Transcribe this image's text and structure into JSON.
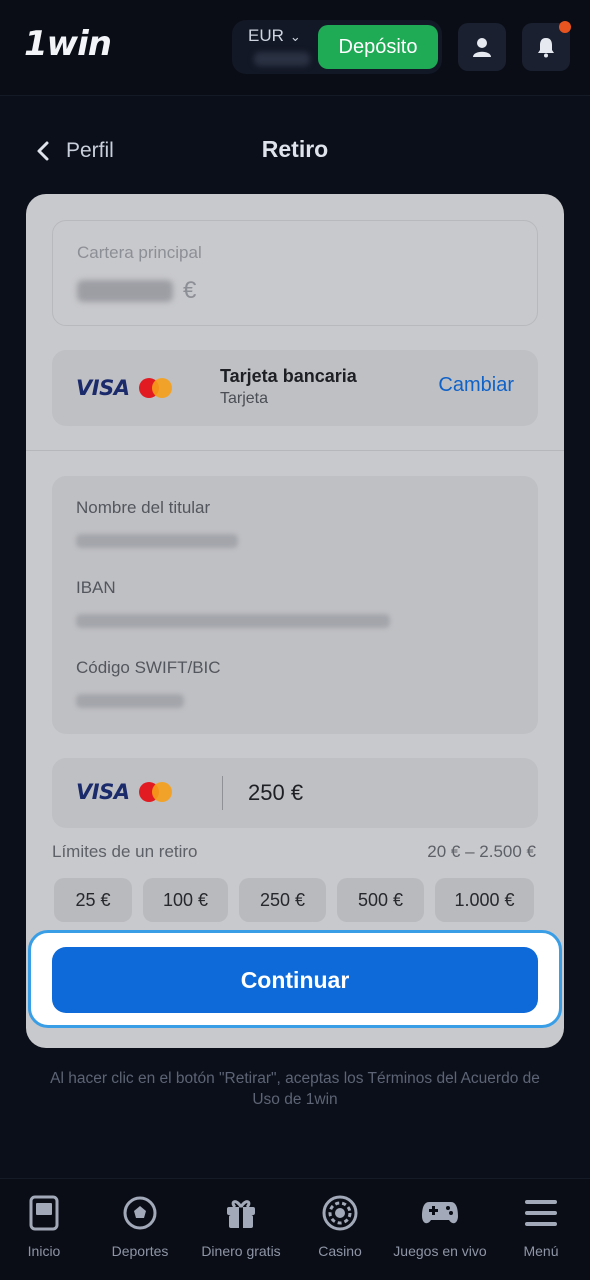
{
  "header": {
    "logo": "1win",
    "currency": "EUR",
    "deposit_label": "Depósito"
  },
  "nav": {
    "back_label": "Perfil",
    "title": "Retiro"
  },
  "wallet": {
    "label": "Cartera principal",
    "currency_symbol": "€"
  },
  "method": {
    "brand": "VISA",
    "name": "Tarjeta bancaria",
    "type": "Tarjeta",
    "change_label": "Cambiar"
  },
  "details": {
    "holder_label": "Nombre del titular",
    "iban_label": "IBAN",
    "swift_label": "Código SWIFT/BIC"
  },
  "amount": {
    "brand": "VISA",
    "value": "250 €"
  },
  "limits": {
    "label": "Límites de un retiro",
    "range": "20 € – 2.500 €"
  },
  "chips": [
    "25 €",
    "100 €",
    "250 €",
    "500 €",
    "1.000 €"
  ],
  "continue_label": "Continuar",
  "terms_text": "Al hacer clic en el botón \"Retirar\", aceptas los Términos del Acuerdo de Uso de 1win",
  "bottom_nav": [
    {
      "label": "Inicio",
      "icon": "home-icon"
    },
    {
      "label": "Deportes",
      "icon": "soccer-ball-icon"
    },
    {
      "label": "Dinero gratis",
      "icon": "gift-icon"
    },
    {
      "label": "Casino",
      "icon": "chip-icon"
    },
    {
      "label": "Juegos en vivo",
      "icon": "gamepad-icon"
    },
    {
      "label": "Menú",
      "icon": "menu-icon"
    }
  ],
  "colors": {
    "accent": "#0d6ad8",
    "deposit": "#1faa55",
    "notification": "#e8541f"
  }
}
